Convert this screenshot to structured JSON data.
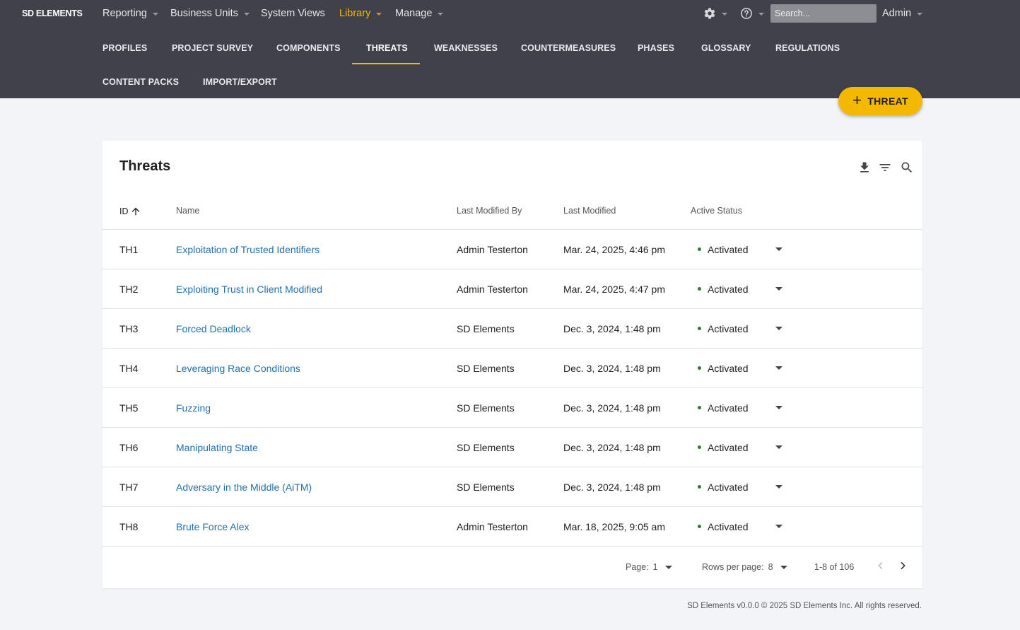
{
  "topnav": {
    "logo": "SD ELEMENTS",
    "items": [
      {
        "label": "Reporting",
        "dropdown": true
      },
      {
        "label": "Business Units",
        "dropdown": true
      },
      {
        "label": "System Views",
        "dropdown": false
      },
      {
        "label": "Library",
        "dropdown": true,
        "active": true
      },
      {
        "label": "Manage",
        "dropdown": true
      }
    ],
    "search_placeholder": "Search...",
    "user": "Admin"
  },
  "subnav": {
    "items": [
      "PROFILES",
      "PROJECT SURVEY",
      "COMPONENTS",
      "THREATS",
      "WEAKNESSES",
      "COUNTERMEASURES",
      "PHASES",
      "GLOSSARY",
      "REGULATIONS",
      "CONTENT PACKS",
      "IMPORT/EXPORT"
    ],
    "active": "THREATS"
  },
  "fab": {
    "label": "THREAT"
  },
  "table": {
    "title": "Threats",
    "columns": {
      "id": "ID",
      "name": "Name",
      "modified_by": "Last Modified By",
      "modified": "Last Modified",
      "status": "Active Status"
    },
    "rows": [
      {
        "id": "TH1",
        "name": "Exploitation of Trusted Identifiers",
        "by": "Admin Testerton",
        "date": "Mar. 24, 2025, 4:46 pm",
        "status": "Activated"
      },
      {
        "id": "TH2",
        "name": "Exploiting Trust in Client Modified",
        "by": "Admin Testerton",
        "date": "Mar. 24, 2025, 4:47 pm",
        "status": "Activated"
      },
      {
        "id": "TH3",
        "name": "Forced Deadlock",
        "by": "SD Elements",
        "date": "Dec. 3, 2024, 1:48 pm",
        "status": "Activated"
      },
      {
        "id": "TH4",
        "name": "Leveraging Race Conditions",
        "by": "SD Elements",
        "date": "Dec. 3, 2024, 1:48 pm",
        "status": "Activated"
      },
      {
        "id": "TH5",
        "name": "Fuzzing",
        "by": "SD Elements",
        "date": "Dec. 3, 2024, 1:48 pm",
        "status": "Activated"
      },
      {
        "id": "TH6",
        "name": "Manipulating State",
        "by": "SD Elements",
        "date": "Dec. 3, 2024, 1:48 pm",
        "status": "Activated"
      },
      {
        "id": "TH7",
        "name": "Adversary in the Middle (AiTM)",
        "by": "SD Elements",
        "date": "Dec. 3, 2024, 1:48 pm",
        "status": "Activated"
      },
      {
        "id": "TH8",
        "name": "Brute Force Alex",
        "by": "Admin Testerton",
        "date": "Mar. 18, 2025, 9:05 am",
        "status": "Activated"
      }
    ]
  },
  "pagination": {
    "page_label": "Page:",
    "page": "1",
    "rows_label": "Rows per page:",
    "rows": "8",
    "range": "1-8 of 106"
  },
  "footer": "SD Elements v0.0.0 © 2025 SD Elements Inc. All rights reserved.",
  "colors": {
    "header": "#41414b",
    "accent": "#f5b800",
    "link": "#1f6fb2",
    "active_dot": "#2e7d32"
  }
}
